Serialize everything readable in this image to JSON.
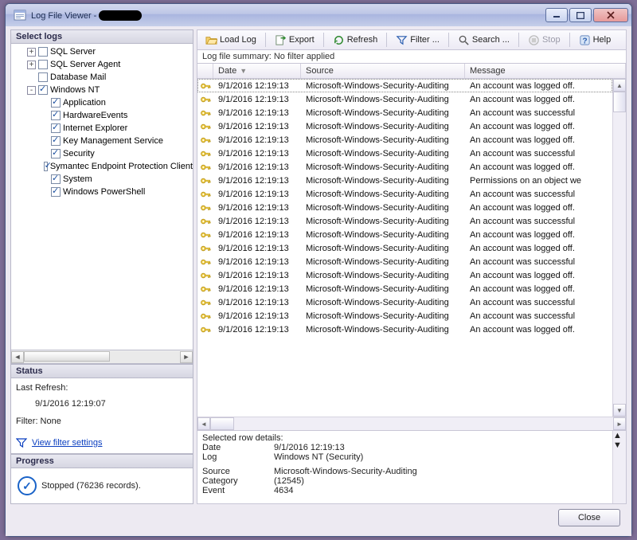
{
  "window": {
    "title_prefix": "Log File Viewer - "
  },
  "left": {
    "select_logs": "Select logs",
    "tree": [
      {
        "expand": "+",
        "checked": false,
        "label": "SQL Server",
        "indent": 1
      },
      {
        "expand": "+",
        "checked": false,
        "label": "SQL Server Agent",
        "indent": 1
      },
      {
        "expand": "",
        "checked": false,
        "label": "Database Mail",
        "indent": 1
      },
      {
        "expand": "-",
        "checked": true,
        "label": "Windows NT",
        "indent": 1
      },
      {
        "expand": "",
        "checked": true,
        "label": "Application",
        "indent": 2
      },
      {
        "expand": "",
        "checked": true,
        "label": "HardwareEvents",
        "indent": 2
      },
      {
        "expand": "",
        "checked": true,
        "label": "Internet Explorer",
        "indent": 2
      },
      {
        "expand": "",
        "checked": true,
        "label": "Key Management Service",
        "indent": 2
      },
      {
        "expand": "",
        "checked": true,
        "label": "Security",
        "indent": 2
      },
      {
        "expand": "",
        "checked": true,
        "label": "Symantec Endpoint Protection Client",
        "indent": 2
      },
      {
        "expand": "",
        "checked": true,
        "label": "System",
        "indent": 2
      },
      {
        "expand": "",
        "checked": true,
        "label": "Windows PowerShell",
        "indent": 2
      }
    ],
    "status_hd": "Status",
    "last_refresh_lbl": "Last Refresh:",
    "last_refresh_val": "9/1/2016 12:19:07",
    "filter_lbl": "Filter: None",
    "filter_link": "View filter settings",
    "progress_hd": "Progress",
    "progress_txt": "Stopped (76236 records)."
  },
  "toolbar": {
    "load": "Load Log",
    "export": "Export",
    "refresh": "Refresh",
    "filter": "Filter ...",
    "search": "Search ...",
    "stop": "Stop",
    "help": "Help"
  },
  "summary": "Log file summary: No filter applied",
  "columns": {
    "date": "Date",
    "source": "Source",
    "message": "Message"
  },
  "rows": [
    {
      "date": "9/1/2016 12:19:13",
      "source": "Microsoft-Windows-Security-Auditing",
      "msg": "An account was logged off."
    },
    {
      "date": "9/1/2016 12:19:13",
      "source": "Microsoft-Windows-Security-Auditing",
      "msg": "An account was logged off."
    },
    {
      "date": "9/1/2016 12:19:13",
      "source": "Microsoft-Windows-Security-Auditing",
      "msg": "An account was successful"
    },
    {
      "date": "9/1/2016 12:19:13",
      "source": "Microsoft-Windows-Security-Auditing",
      "msg": "An account was logged off."
    },
    {
      "date": "9/1/2016 12:19:13",
      "source": "Microsoft-Windows-Security-Auditing",
      "msg": "An account was logged off."
    },
    {
      "date": "9/1/2016 12:19:13",
      "source": "Microsoft-Windows-Security-Auditing",
      "msg": "An account was successful"
    },
    {
      "date": "9/1/2016 12:19:13",
      "source": "Microsoft-Windows-Security-Auditing",
      "msg": "An account was logged off."
    },
    {
      "date": "9/1/2016 12:19:13",
      "source": "Microsoft-Windows-Security-Auditing",
      "msg": "Permissions on an object we"
    },
    {
      "date": "9/1/2016 12:19:13",
      "source": "Microsoft-Windows-Security-Auditing",
      "msg": "An account was successful"
    },
    {
      "date": "9/1/2016 12:19:13",
      "source": "Microsoft-Windows-Security-Auditing",
      "msg": "An account was logged off."
    },
    {
      "date": "9/1/2016 12:19:13",
      "source": "Microsoft-Windows-Security-Auditing",
      "msg": "An account was successful"
    },
    {
      "date": "9/1/2016 12:19:13",
      "source": "Microsoft-Windows-Security-Auditing",
      "msg": "An account was logged off."
    },
    {
      "date": "9/1/2016 12:19:13",
      "source": "Microsoft-Windows-Security-Auditing",
      "msg": "An account was logged off."
    },
    {
      "date": "9/1/2016 12:19:13",
      "source": "Microsoft-Windows-Security-Auditing",
      "msg": "An account was successful"
    },
    {
      "date": "9/1/2016 12:19:13",
      "source": "Microsoft-Windows-Security-Auditing",
      "msg": "An account was logged off."
    },
    {
      "date": "9/1/2016 12:19:13",
      "source": "Microsoft-Windows-Security-Auditing",
      "msg": "An account was logged off."
    },
    {
      "date": "9/1/2016 12:19:13",
      "source": "Microsoft-Windows-Security-Auditing",
      "msg": "An account was successful"
    },
    {
      "date": "9/1/2016 12:19:13",
      "source": "Microsoft-Windows-Security-Auditing",
      "msg": "An account was successful"
    },
    {
      "date": "9/1/2016 12:19:13",
      "source": "Microsoft-Windows-Security-Auditing",
      "msg": "An account was logged off."
    }
  ],
  "details": {
    "header": "Selected row details:",
    "date_lbl": "Date",
    "date_val": "9/1/2016 12:19:13",
    "log_lbl": "Log",
    "log_val": "Windows NT (Security)",
    "source_lbl": "Source",
    "source_val": "Microsoft-Windows-Security-Auditing",
    "cat_lbl": "Category",
    "cat_val": "(12545)",
    "event_lbl": "Event",
    "event_val": "4634"
  },
  "close": "Close"
}
